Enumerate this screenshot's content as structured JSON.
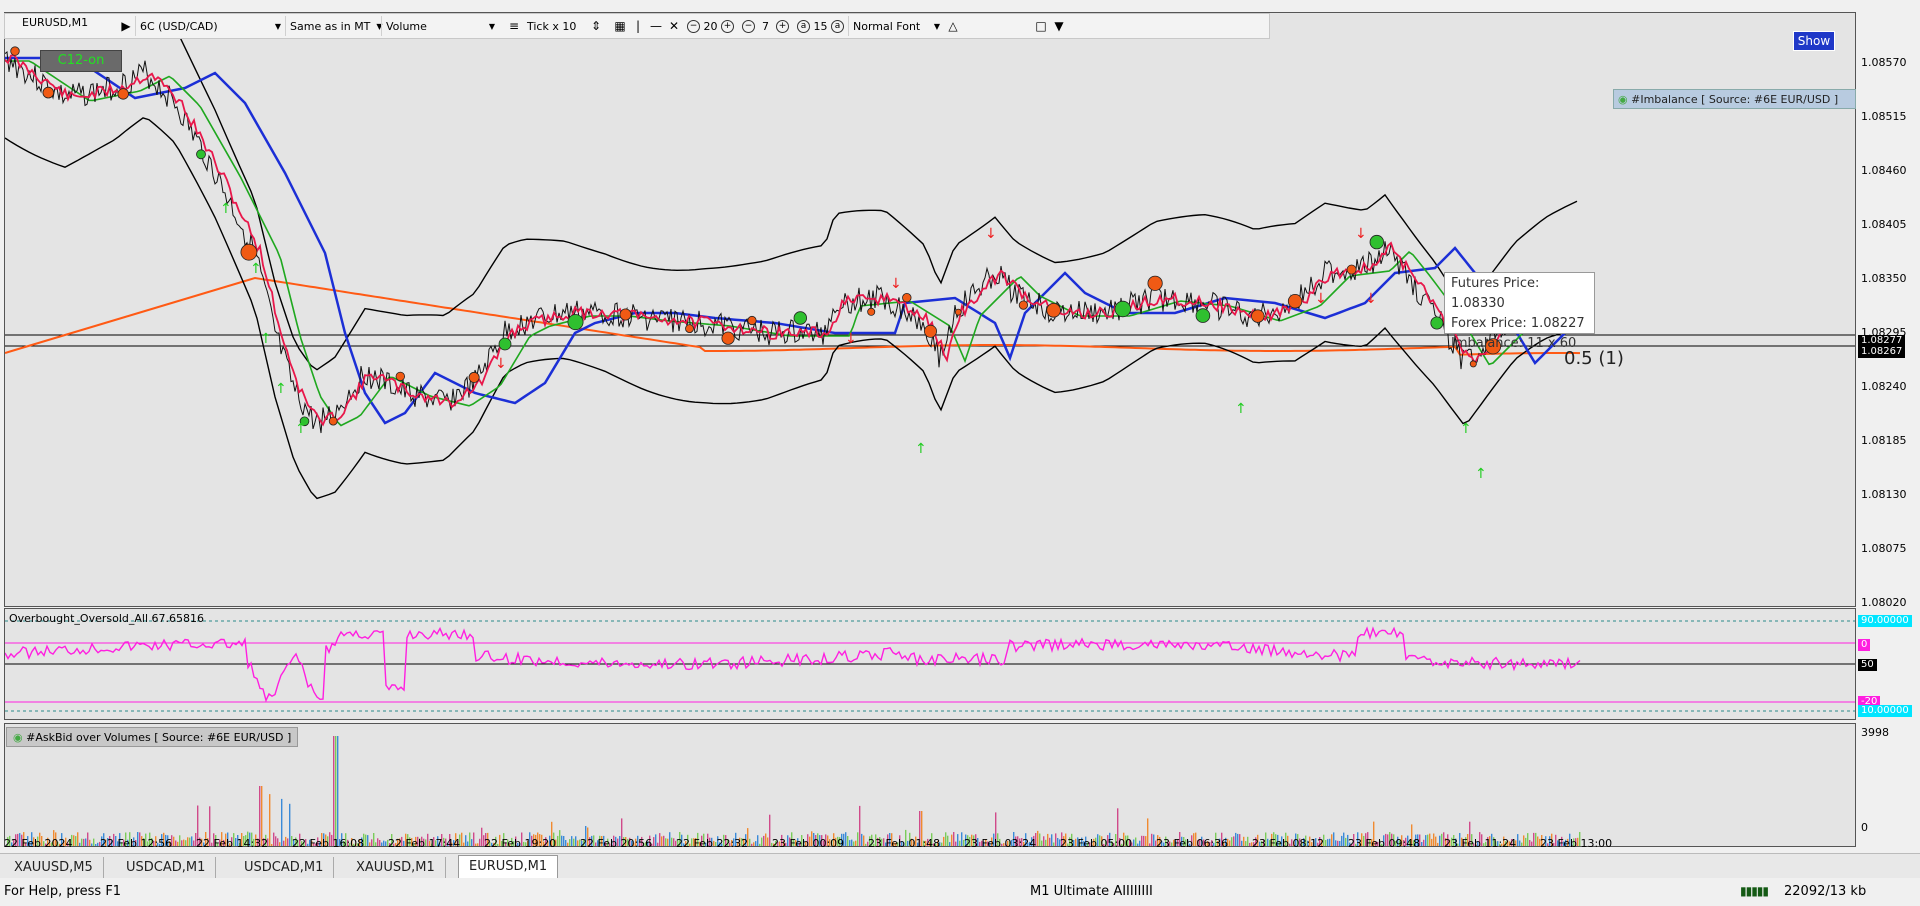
{
  "chart": {
    "symbol_title": "EURUSD,M1",
    "c12_button": "C12-on",
    "show_button": "Show",
    "imbalance_indicator": "#Imbalance [ Source: #6E EUR/USD ]",
    "tooltip": {
      "futures": "Futures Price: 1.08330",
      "forex": "Forex Price: 1.08227",
      "imbalance": "Imbalance: 11 x 60"
    },
    "ratio_label": "0.5 (1)",
    "price_axis": [
      "1.08570",
      "1.08515",
      "1.08460",
      "1.08405",
      "1.08350",
      "1.08295",
      "1.08240",
      "1.08185",
      "1.08130",
      "1.08075",
      "1.08020"
    ],
    "current_price_top": "1.08277",
    "current_price_bottom": "1.08267",
    "colors": {
      "ema_fast": "#e8174a",
      "ema_mid": "#1fa81f",
      "ema_slow": "#1c2fd6",
      "ma_long": "#ff5a14",
      "bands": "#000000",
      "buy_arrow": "#22cc22",
      "sell_arrow": "#ee2020",
      "oscillator": "#ff1fe0"
    }
  },
  "toolbar": {
    "play_icon": "play-icon",
    "instrument": "6C (USD/CAD)",
    "time_mode": "Same as in MT",
    "metric": "Volume",
    "tick": "Tick x 10",
    "minus20": "20",
    "minus7": "7",
    "minus15": "15",
    "font": "Normal Font"
  },
  "oscillator": {
    "label": "Overbought_Oversold_All 67.65816",
    "levels": {
      "upper": "90.00000",
      "mid_pink": "0",
      "fifty": "50",
      "low_pink": "-20",
      "lower": "10.00000"
    }
  },
  "volume_panel": {
    "label": "#AskBid over Volumes [ Source: #6E EUR/USD ]",
    "max": "3998",
    "min": "0"
  },
  "time_axis": [
    "22 Feb 2024",
    "22 Feb 12:56",
    "22 Feb 14:32",
    "22 Feb 16:08",
    "22 Feb 17:44",
    "22 Feb 19:20",
    "22 Feb 20:56",
    "22 Feb 22:32",
    "23 Feb 00:09",
    "23 Feb 01:48",
    "23 Feb 03:24",
    "23 Feb 05:00",
    "23 Feb 06:36",
    "23 Feb 08:12",
    "23 Feb 09:48",
    "23 Feb 11:24",
    "23 Feb 13:00"
  ],
  "tabs": [
    {
      "label": "XAUUSD,M5",
      "active": false
    },
    {
      "label": "USDCAD,M1",
      "active": false
    },
    {
      "label": "USDCAD,M1",
      "active": false
    },
    {
      "label": "XAUUSD,M1",
      "active": false
    },
    {
      "label": "EURUSD,M1",
      "active": true
    }
  ],
  "status": {
    "help": "For Help, press F1",
    "profile": "M1 Ultimate AIIIIIIII",
    "traffic": "22092/13 kb"
  }
}
